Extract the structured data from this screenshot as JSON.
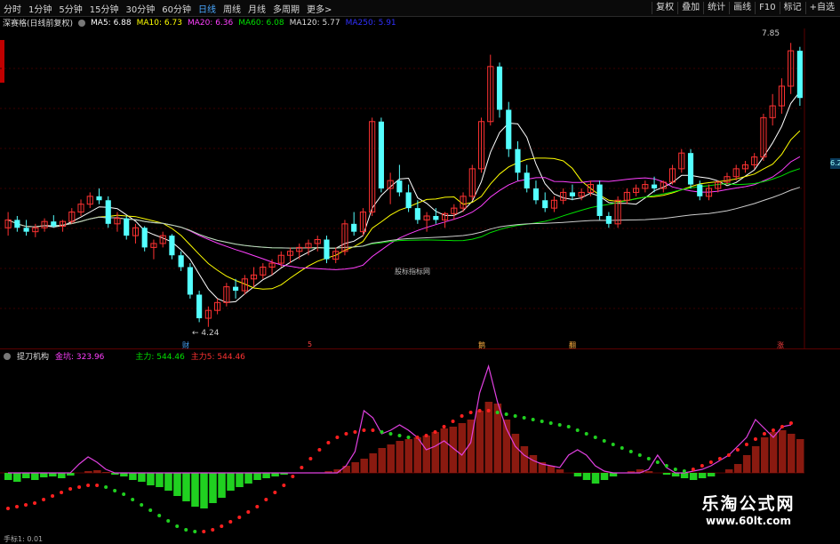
{
  "toolbar": {
    "periods": [
      "分时",
      "1分钟",
      "5分钟",
      "15分钟",
      "30分钟",
      "60分钟",
      "日线",
      "周线",
      "月线",
      "多周期",
      "更多"
    ],
    "active": "日线",
    "more_arrow": ">",
    "right_buttons": [
      "复权",
      "叠加",
      "统计",
      "画线",
      "F10",
      "标记",
      "+自选"
    ]
  },
  "info": {
    "title": "深赛格(日线前复权)",
    "ma5": "MA5: 6.88",
    "ma10": "MA10: 6.73",
    "ma20": "MA20: 6.36",
    "ma60": "MA60: 6.08",
    "ma120": "MA120: 5.77",
    "ma250": "MA250: 5.91"
  },
  "chart_labels": {
    "high": "7.85",
    "low": "4.24",
    "watermark": "股标指标网",
    "right_price": "6.2",
    "markers": [
      "财",
      "5",
      "鹅",
      "翻",
      "涨"
    ]
  },
  "indicator": {
    "name": "提刀机构",
    "jinkeng": "金坑: 323.96",
    "zhuli": "主力: 544.46",
    "zhuli5": "主力5: 544.46"
  },
  "watermark": {
    "line1": "乐淘公式网",
    "line2": "www.60lt.com"
  },
  "bottom_text": "手标1: 0.01",
  "colors": {
    "up": "#ff3232",
    "down": "#54ffff",
    "ma5": "#ffffff",
    "ma10": "#ffff00",
    "ma20": "#ff40ff",
    "ma60": "#00e000",
    "ma120": "#cccccc",
    "ma250": "#3030ff",
    "active_tab": "#4aa8ff"
  },
  "chart_data": [
    {
      "type": "candlestick",
      "title": "深赛格(日线前复权)",
      "ylim": [
        4.0,
        8.0
      ],
      "series": [
        {
          "name": "K",
          "ohlc": [
            [
              5.5,
              5.7,
              5.4,
              5.6
            ],
            [
              5.6,
              5.65,
              5.45,
              5.5
            ],
            [
              5.5,
              5.6,
              5.4,
              5.45
            ],
            [
              5.45,
              5.55,
              5.38,
              5.5
            ],
            [
              5.5,
              5.62,
              5.45,
              5.58
            ],
            [
              5.58,
              5.66,
              5.5,
              5.52
            ],
            [
              5.52,
              5.6,
              5.45,
              5.58
            ],
            [
              5.58,
              5.75,
              5.55,
              5.7
            ],
            [
              5.7,
              5.86,
              5.65,
              5.8
            ],
            [
              5.8,
              5.95,
              5.75,
              5.9
            ],
            [
              5.9,
              6.0,
              5.8,
              5.85
            ],
            [
              5.85,
              5.9,
              5.5,
              5.55
            ],
            [
              5.55,
              5.7,
              5.45,
              5.62
            ],
            [
              5.62,
              5.65,
              5.35,
              5.4
            ],
            [
              5.4,
              5.55,
              5.3,
              5.5
            ],
            [
              5.5,
              5.52,
              5.2,
              5.25
            ],
            [
              5.25,
              5.35,
              5.1,
              5.3
            ],
            [
              5.3,
              5.45,
              5.25,
              5.4
            ],
            [
              5.4,
              5.42,
              5.1,
              5.15
            ],
            [
              5.15,
              5.2,
              4.95,
              5.0
            ],
            [
              5.0,
              5.05,
              4.6,
              4.65
            ],
            [
              4.65,
              4.7,
              4.3,
              4.35
            ],
            [
              4.35,
              4.5,
              4.24,
              4.45
            ],
            [
              4.45,
              4.6,
              4.4,
              4.55
            ],
            [
              4.55,
              4.8,
              4.5,
              4.75
            ],
            [
              4.75,
              4.85,
              4.6,
              4.7
            ],
            [
              4.7,
              4.9,
              4.65,
              4.85
            ],
            [
              4.85,
              5.0,
              4.75,
              4.9
            ],
            [
              4.9,
              5.05,
              4.85,
              5.0
            ],
            [
              5.0,
              5.1,
              4.9,
              5.05
            ],
            [
              5.05,
              5.2,
              5.0,
              5.15
            ],
            [
              5.15,
              5.25,
              5.05,
              5.2
            ],
            [
              5.2,
              5.3,
              5.1,
              5.25
            ],
            [
              5.25,
              5.35,
              5.15,
              5.3
            ],
            [
              5.3,
              5.4,
              5.2,
              5.35
            ],
            [
              5.35,
              5.4,
              5.05,
              5.1
            ],
            [
              5.1,
              5.25,
              5.05,
              5.2
            ],
            [
              5.2,
              5.6,
              5.15,
              5.55
            ],
            [
              5.55,
              5.7,
              5.4,
              5.45
            ],
            [
              5.45,
              5.75,
              5.4,
              5.7
            ],
            [
              5.7,
              6.9,
              5.65,
              6.85
            ],
            [
              6.85,
              6.9,
              5.95,
              6.0
            ],
            [
              6.0,
              6.2,
              5.8,
              6.1
            ],
            [
              6.1,
              6.3,
              5.9,
              5.95
            ],
            [
              5.95,
              6.05,
              5.7,
              5.75
            ],
            [
              5.75,
              5.85,
              5.55,
              5.6
            ],
            [
              5.6,
              5.7,
              5.45,
              5.65
            ],
            [
              5.65,
              5.75,
              5.55,
              5.6
            ],
            [
              5.6,
              5.7,
              5.5,
              5.68
            ],
            [
              5.68,
              5.8,
              5.6,
              5.75
            ],
            [
              5.75,
              5.95,
              5.7,
              5.9
            ],
            [
              5.9,
              6.3,
              5.85,
              6.25
            ],
            [
              6.25,
              6.9,
              6.2,
              6.85
            ],
            [
              6.85,
              7.7,
              6.8,
              7.55
            ],
            [
              7.55,
              7.6,
              6.9,
              7.0
            ],
            [
              7.0,
              7.1,
              6.4,
              6.5
            ],
            [
              6.5,
              6.6,
              6.1,
              6.2
            ],
            [
              6.2,
              6.3,
              5.95,
              6.0
            ],
            [
              6.0,
              6.1,
              5.8,
              5.85
            ],
            [
              5.85,
              5.95,
              5.7,
              5.75
            ],
            [
              5.75,
              5.9,
              5.7,
              5.85
            ],
            [
              5.85,
              6.0,
              5.8,
              5.95
            ],
            [
              5.95,
              6.05,
              5.85,
              5.9
            ],
            [
              5.9,
              6.0,
              5.85,
              5.95
            ],
            [
              5.95,
              6.1,
              5.9,
              6.05
            ],
            [
              6.05,
              6.1,
              5.6,
              5.65
            ],
            [
              5.65,
              5.7,
              5.5,
              5.55
            ],
            [
              5.55,
              5.9,
              5.5,
              5.85
            ],
            [
              5.85,
              6.0,
              5.8,
              5.95
            ],
            [
              5.95,
              6.05,
              5.9,
              6.0
            ],
            [
              6.0,
              6.1,
              5.95,
              6.05
            ],
            [
              6.05,
              6.15,
              5.95,
              6.0
            ],
            [
              6.0,
              6.1,
              5.95,
              6.08
            ],
            [
              6.08,
              6.3,
              6.05,
              6.25
            ],
            [
              6.25,
              6.5,
              6.2,
              6.45
            ],
            [
              6.45,
              6.5,
              6.0,
              6.05
            ],
            [
              6.05,
              6.1,
              5.85,
              5.9
            ],
            [
              5.9,
              6.05,
              5.85,
              6.0
            ],
            [
              6.0,
              6.1,
              5.95,
              6.08
            ],
            [
              6.08,
              6.2,
              6.05,
              6.15
            ],
            [
              6.15,
              6.3,
              6.1,
              6.25
            ],
            [
              6.25,
              6.35,
              6.2,
              6.3
            ],
            [
              6.3,
              6.45,
              6.25,
              6.4
            ],
            [
              6.4,
              6.95,
              6.35,
              6.9
            ],
            [
              6.9,
              7.2,
              6.8,
              7.05
            ],
            [
              7.05,
              7.4,
              6.95,
              7.3
            ],
            [
              7.3,
              7.85,
              7.2,
              7.75
            ],
            [
              7.75,
              7.8,
              7.05,
              7.15
            ]
          ]
        }
      ]
    },
    {
      "type": "bar",
      "title": "提刀机构",
      "series": [
        {
          "name": "金坑",
          "values": [
            -8,
            -10,
            -6,
            -8,
            -5,
            -4,
            -6,
            -3,
            0,
            2,
            3,
            1,
            -2,
            -4,
            -8,
            -10,
            -14,
            -16,
            -20,
            -26,
            -32,
            -38,
            -40,
            -34,
            -28,
            -20,
            -16,
            -12,
            -8,
            -6,
            -4,
            -2,
            0,
            0,
            0,
            0,
            2,
            4,
            8,
            12,
            16,
            22,
            28,
            32,
            36,
            38,
            40,
            42,
            46,
            50,
            52,
            56,
            60,
            70,
            80,
            78,
            60,
            44,
            30,
            20,
            12,
            8,
            4,
            0,
            -4,
            -8,
            -12,
            -8,
            -4,
            0,
            2,
            4,
            2,
            0,
            -2,
            -4,
            -6,
            -8,
            -6,
            -4,
            0,
            4,
            10,
            20,
            30,
            40,
            46,
            48,
            44,
            38
          ]
        },
        {
          "name": "主力",
          "values": [
            0,
            0,
            0,
            0,
            0,
            0,
            0,
            0,
            10,
            18,
            12,
            4,
            0,
            0,
            0,
            0,
            0,
            0,
            0,
            0,
            0,
            0,
            0,
            0,
            0,
            0,
            0,
            0,
            0,
            0,
            0,
            0,
            0,
            0,
            0,
            0,
            0,
            0,
            8,
            24,
            70,
            62,
            44,
            48,
            54,
            48,
            40,
            26,
            30,
            36,
            28,
            20,
            34,
            90,
            120,
            80,
            50,
            30,
            20,
            14,
            10,
            8,
            6,
            20,
            26,
            20,
            8,
            2,
            0,
            0,
            0,
            0,
            4,
            20,
            6,
            0,
            0,
            2,
            4,
            8,
            14,
            20,
            30,
            40,
            60,
            50,
            40,
            52,
            54
          ]
        },
        {
          "name": "主力5",
          "values": [
            -40,
            -38,
            -36,
            -34,
            -30,
            -26,
            -22,
            -18,
            -16,
            -14,
            -14,
            -16,
            -20,
            -24,
            -30,
            -36,
            -42,
            -48,
            -54,
            -60,
            -64,
            -66,
            -66,
            -64,
            -60,
            -55,
            -50,
            -44,
            -38,
            -30,
            -22,
            -14,
            -4,
            6,
            16,
            26,
            34,
            40,
            44,
            46,
            48,
            48,
            46,
            44,
            42,
            40,
            40,
            42,
            46,
            52,
            58,
            64,
            68,
            70,
            70,
            68,
            66,
            64,
            62,
            60,
            58,
            56,
            54,
            52,
            48,
            44,
            40,
            36,
            32,
            28,
            24,
            20,
            16,
            12,
            8,
            4,
            2,
            4,
            8,
            12,
            16,
            20,
            26,
            32,
            38,
            44,
            48,
            52,
            56
          ]
        }
      ]
    }
  ]
}
